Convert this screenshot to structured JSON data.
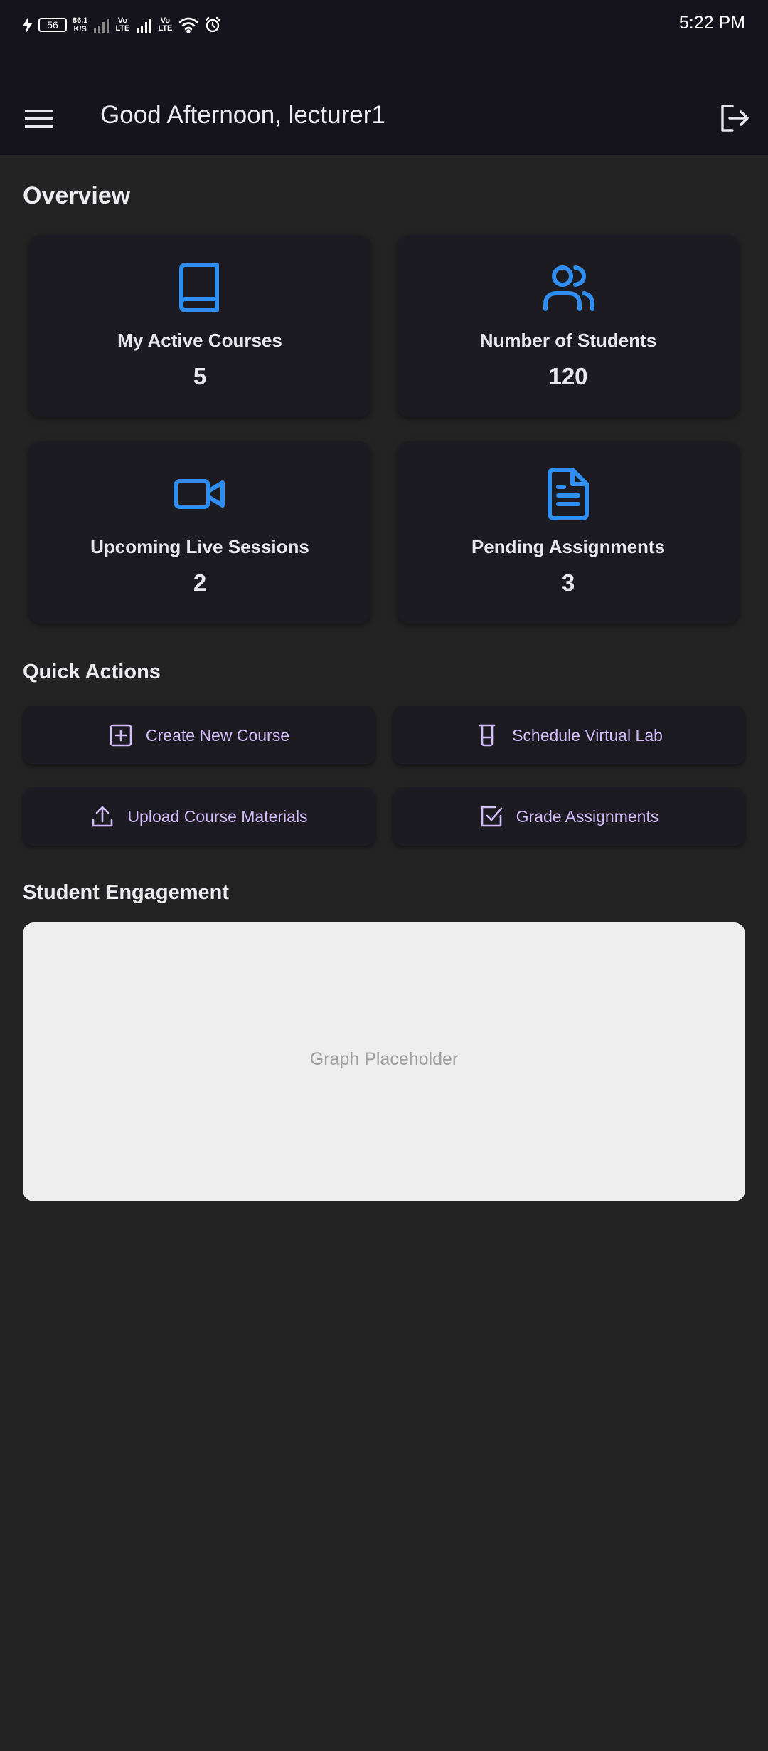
{
  "status_bar": {
    "battery": "56",
    "net_speed_top": "86.1",
    "net_speed_unit": "K/S",
    "sim1": "Vo LTE",
    "sim2": "Vo LTE",
    "time": "5:22 PM"
  },
  "app_bar": {
    "greeting": "Good Afternoon, lecturer1",
    "menu_icon": "hamburger-menu-icon",
    "logout_icon": "logout-icon"
  },
  "overview": {
    "title": "Overview",
    "cards": [
      {
        "label": "My Active Courses",
        "value": "5",
        "icon": "book-icon"
      },
      {
        "label": "Number of Students",
        "value": "120",
        "icon": "users-icon"
      },
      {
        "label": "Upcoming Live Sessions",
        "value": "2",
        "icon": "video-camera-icon"
      },
      {
        "label": "Pending Assignments",
        "value": "3",
        "icon": "document-icon"
      }
    ],
    "icon_color": "#2f8ef0"
  },
  "quick_actions": {
    "title": "Quick Actions",
    "buttons": [
      {
        "label": "Create New Course",
        "icon": "plus-square-icon"
      },
      {
        "label": "Schedule Virtual Lab",
        "icon": "beaker-icon"
      },
      {
        "label": "Upload Course Materials",
        "icon": "upload-icon"
      },
      {
        "label": "Grade Assignments",
        "icon": "check-square-icon"
      }
    ],
    "accent_color": "#d3bcfb"
  },
  "student_engagement": {
    "title": "Student Engagement",
    "placeholder": "Graph Placeholder"
  }
}
